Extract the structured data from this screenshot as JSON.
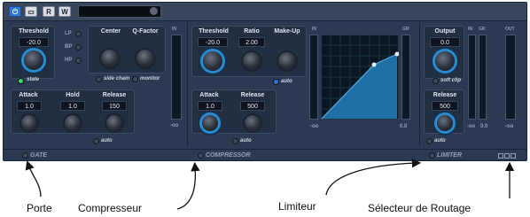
{
  "toolbar": {
    "power_label": "⏻",
    "btn2_label": "▭",
    "btn3_label": "R",
    "btn4_label": "W"
  },
  "gate": {
    "threshold_label": "Threshold",
    "threshold_value": "-20.0",
    "state_label": "state",
    "filter_lp": "LP",
    "filter_bp": "BP",
    "filter_hp": "HP",
    "center_label": "Center",
    "qfactor_label": "Q-Factor",
    "side_chain_label": "side chain",
    "monitor_label": "monitor",
    "attack_label": "Attack",
    "attack_value": "1.0",
    "hold_label": "Hold",
    "hold_value": "1.0",
    "release_label": "Release",
    "release_value": "150",
    "auto_label": "auto",
    "meter_top": "IN",
    "meter_bottom": "-oo",
    "section_label": "GATE"
  },
  "compressor": {
    "threshold_label": "Threshold",
    "threshold_value": "-20.0",
    "ratio_label": "Ratio",
    "ratio_value": "2.00",
    "makeup_label": "Make-Up",
    "makeup_auto": "auto",
    "attack_label": "Attack",
    "attack_value": "1.0",
    "release_label": "Release",
    "release_value": "500",
    "auto_label": "auto",
    "graph_in": "IN",
    "graph_gr": "GR",
    "graph_bottom_left": "-oo",
    "graph_bottom_right": "0.0",
    "section_label": "COMPRESSOR"
  },
  "limiter": {
    "output_label": "Output",
    "output_value": "0.0",
    "soft_clip_label": "soft clip",
    "release_label": "Release",
    "release_value": "500",
    "auto_label": "auto",
    "meter_in": "IN",
    "meter_gr": "GR",
    "meter_bottom_left": "-oo",
    "meter_bottom_right": "0.0",
    "out_meter_top": "OUT",
    "out_meter_bottom": "-oo",
    "section_label": "LIMITER"
  },
  "captions": {
    "gate": "Porte",
    "compressor": "Compresseur",
    "limiter": "Limiteur",
    "routing": "Sélecteur de Routage"
  }
}
